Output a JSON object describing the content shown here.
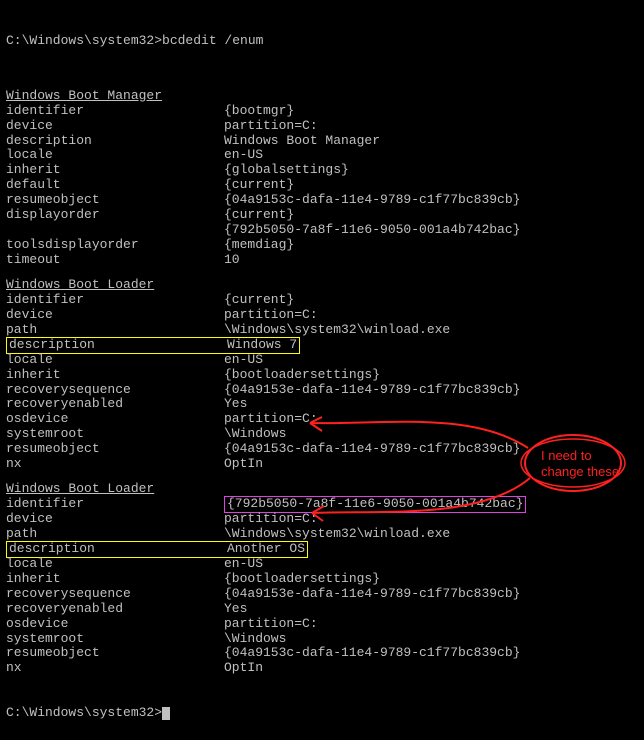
{
  "prompt_line": "C:\\Windows\\system32>bcdedit /enum",
  "sections": [
    {
      "title": "Windows Boot Manager",
      "rows": [
        {
          "k": "identifier",
          "v": "{bootmgr}"
        },
        {
          "k": "device",
          "v": "partition=C:"
        },
        {
          "k": "description",
          "v": "Windows Boot Manager"
        },
        {
          "k": "locale",
          "v": "en-US"
        },
        {
          "k": "inherit",
          "v": "{globalsettings}"
        },
        {
          "k": "default",
          "v": "{current}"
        },
        {
          "k": "resumeobject",
          "v": "{04a9153c-dafa-11e4-9789-c1f77bc839cb}"
        },
        {
          "k": "displayorder",
          "v": "{current}"
        },
        {
          "k": "",
          "v": "{792b5050-7a8f-11e6-9050-001a4b742bac}"
        },
        {
          "k": "toolsdisplayorder",
          "v": "{memdiag}"
        },
        {
          "k": "timeout",
          "v": "10"
        }
      ]
    },
    {
      "title": "Windows Boot Loader",
      "rows": [
        {
          "k": "identifier",
          "v": "{current}"
        },
        {
          "k": "device",
          "v": "partition=C:"
        },
        {
          "k": "path",
          "v": "\\Windows\\system32\\winload.exe"
        },
        {
          "k": "description",
          "v": "Windows 7",
          "hl": "yellow-kv"
        },
        {
          "k": "locale",
          "v": "en-US"
        },
        {
          "k": "inherit",
          "v": "{bootloadersettings}"
        },
        {
          "k": "recoverysequence",
          "v": "{04a9153e-dafa-11e4-9789-c1f77bc839cb}"
        },
        {
          "k": "recoveryenabled",
          "v": "Yes"
        },
        {
          "k": "osdevice",
          "v": "partition=C:"
        },
        {
          "k": "systemroot",
          "v": "\\Windows"
        },
        {
          "k": "resumeobject",
          "v": "{04a9153c-dafa-11e4-9789-c1f77bc839cb}"
        },
        {
          "k": "nx",
          "v": "OptIn"
        }
      ]
    },
    {
      "title": "Windows Boot Loader",
      "rows": [
        {
          "k": "identifier",
          "v": "{792b5050-7a8f-11e6-9050-001a4b742bac}",
          "hl": "magenta-v"
        },
        {
          "k": "device",
          "v": "partition=C:",
          "arrow": true
        },
        {
          "k": "path",
          "v": "\\Windows\\system32\\winload.exe"
        },
        {
          "k": "description",
          "v": "Another OS",
          "hl": "yellow-kv"
        },
        {
          "k": "locale",
          "v": "en-US"
        },
        {
          "k": "inherit",
          "v": "{bootloadersettings}"
        },
        {
          "k": "recoverysequence",
          "v": "{04a9153e-dafa-11e4-9789-c1f77bc839cb}"
        },
        {
          "k": "recoveryenabled",
          "v": "Yes"
        },
        {
          "k": "osdevice",
          "v": "partition=C:",
          "arrow": true
        },
        {
          "k": "systemroot",
          "v": "\\Windows"
        },
        {
          "k": "resumeobject",
          "v": "{04a9153c-dafa-11e4-9789-c1f77bc839cb}"
        },
        {
          "k": "nx",
          "v": "OptIn"
        }
      ]
    }
  ],
  "prompt_final": "C:\\Windows\\system32>",
  "annotation_text": "I need to\nchange these"
}
